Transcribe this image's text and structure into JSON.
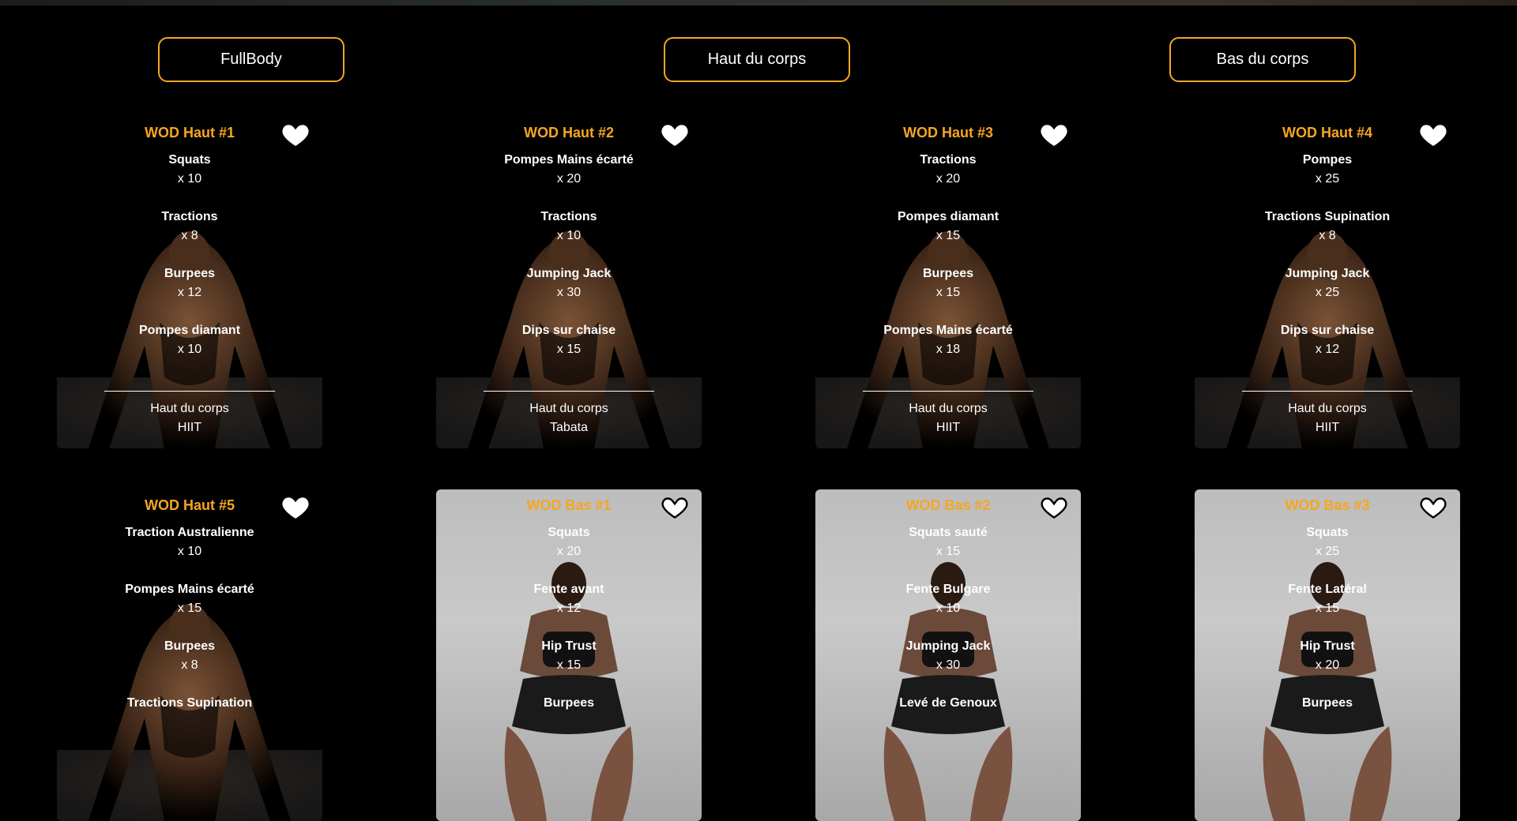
{
  "filters": [
    {
      "label": "FullBody"
    },
    {
      "label": "Haut du corps"
    },
    {
      "label": "Bas du corps"
    }
  ],
  "cards": [
    {
      "title": "WOD Haut #1",
      "kind": "haut",
      "exercises": [
        {
          "name": "Squats",
          "reps": "x 10"
        },
        {
          "name": "Tractions",
          "reps": "x 8"
        },
        {
          "name": "Burpees",
          "reps": "x 12"
        },
        {
          "name": "Pompes diamant",
          "reps": "x 10"
        }
      ],
      "category": "Haut du corps",
      "type": "HIIT"
    },
    {
      "title": "WOD Haut #2",
      "kind": "haut",
      "exercises": [
        {
          "name": "Pompes Mains écarté",
          "reps": "x 20"
        },
        {
          "name": "Tractions",
          "reps": "x 10"
        },
        {
          "name": "Jumping Jack",
          "reps": "x 30"
        },
        {
          "name": "Dips sur chaise",
          "reps": "x 15"
        }
      ],
      "category": "Haut du corps",
      "type": "Tabata"
    },
    {
      "title": "WOD Haut #3",
      "kind": "haut",
      "exercises": [
        {
          "name": "Tractions",
          "reps": "x 20"
        },
        {
          "name": "Pompes diamant",
          "reps": "x 15"
        },
        {
          "name": "Burpees",
          "reps": "x 15"
        },
        {
          "name": "Pompes Mains écarté",
          "reps": "x 18"
        }
      ],
      "category": "Haut du corps",
      "type": "HIIT"
    },
    {
      "title": "WOD Haut #4",
      "kind": "haut",
      "exercises": [
        {
          "name": "Pompes",
          "reps": "x 25"
        },
        {
          "name": "Tractions Supination",
          "reps": "x 8"
        },
        {
          "name": "Jumping Jack",
          "reps": "x 25"
        },
        {
          "name": "Dips sur chaise",
          "reps": "x 12"
        }
      ],
      "category": "Haut du corps",
      "type": "HIIT"
    },
    {
      "title": "WOD Haut #5",
      "kind": "haut",
      "exercises": [
        {
          "name": "Traction Australienne",
          "reps": "x 10"
        },
        {
          "name": "Pompes Mains écarté",
          "reps": "x 15"
        },
        {
          "name": "Burpees",
          "reps": "x 8"
        },
        {
          "name": "Tractions Supination",
          "reps": ""
        }
      ],
      "category": "",
      "type": ""
    },
    {
      "title": "WOD Bas #1",
      "kind": "bas",
      "exercises": [
        {
          "name": "Squats",
          "reps": "x 20"
        },
        {
          "name": "Fente avant",
          "reps": "x 12"
        },
        {
          "name": "Hip Trust",
          "reps": "x 15"
        },
        {
          "name": "Burpees",
          "reps": ""
        }
      ],
      "category": "",
      "type": ""
    },
    {
      "title": "WOD Bas #2",
      "kind": "bas",
      "exercises": [
        {
          "name": "Squats sauté",
          "reps": "x 15"
        },
        {
          "name": "Fente Bulgare",
          "reps": "x 10"
        },
        {
          "name": "Jumping Jack",
          "reps": "x 30"
        },
        {
          "name": "Levé de Genoux",
          "reps": ""
        }
      ],
      "category": "",
      "type": ""
    },
    {
      "title": "WOD Bas #3",
      "kind": "bas",
      "exercises": [
        {
          "name": "Squats",
          "reps": "x 25"
        },
        {
          "name": "Fente Latéral",
          "reps": "x 15"
        },
        {
          "name": "Hip Trust",
          "reps": "x 20"
        },
        {
          "name": "Burpees",
          "reps": ""
        }
      ],
      "category": "",
      "type": ""
    }
  ],
  "colors": {
    "accent": "#f5a623",
    "background": "#000000",
    "text": "#ffffff"
  },
  "icons": {
    "favorite": "heart-icon"
  }
}
